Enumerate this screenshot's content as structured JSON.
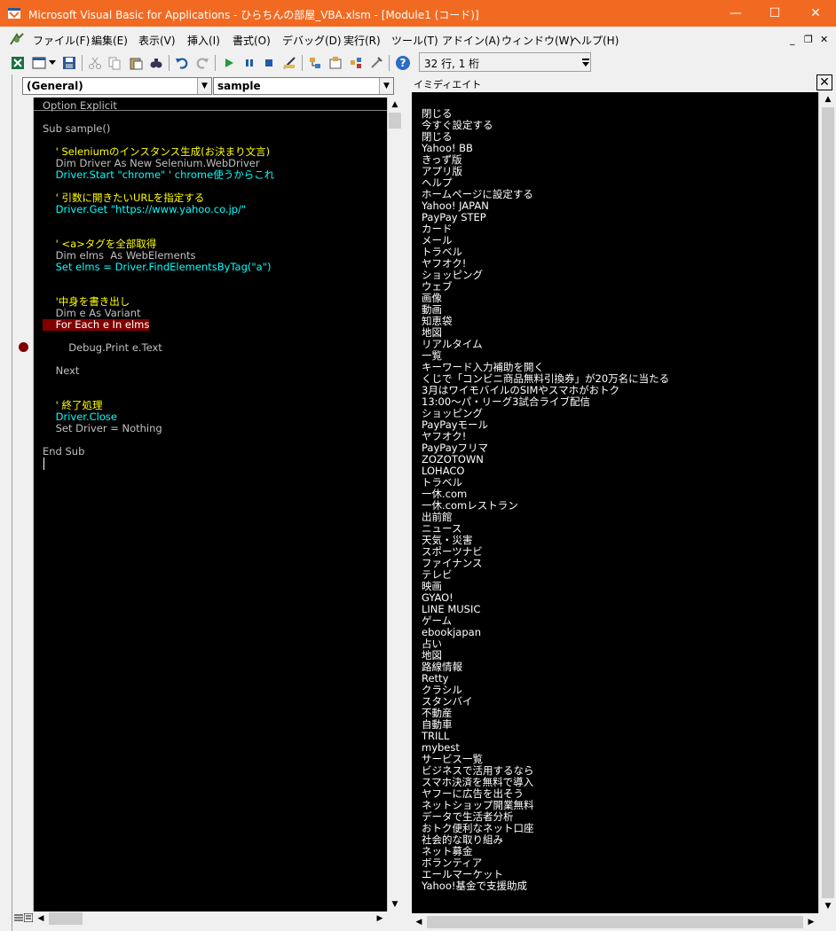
{
  "window": {
    "title": "Microsoft Visual Basic for Applications - ひらちんの部屋_VBA.xlsm - [Module1 (コード)]",
    "minimize": "—",
    "maximize": "☐",
    "close": "✕",
    "accent_color": "#f26a21"
  },
  "menubar": {
    "items": [
      "ファイル(F)",
      "編集(E)",
      "表示(V)",
      "挿入(I)",
      "書式(O)",
      "デバッグ(D)",
      "実行(R)",
      "ツール(T)",
      "アドイン(A)",
      "ウィンドウ(W)",
      "ヘルプ(H)"
    ],
    "mdi_minimize": "_",
    "mdi_restore": "❐",
    "mdi_close": "✕"
  },
  "toolbar": {
    "cursor_position": "32 行, 1 桁"
  },
  "code_window": {
    "object_combo": "(General)",
    "procedure_combo": "sample",
    "lines": [
      {
        "text": "Option Explicit",
        "color": "#c0c0c0"
      },
      {
        "text": "",
        "color": "#c0c0c0"
      },
      {
        "text": "Sub sample()",
        "color": "#c0c0c0"
      },
      {
        "text": "",
        "color": "#c0c0c0"
      },
      {
        "text": "    ' Seleniumのインスタンス生成(お決まり文言)",
        "color": "#ffff00"
      },
      {
        "text": "    Dim Driver As New Selenium.WebDriver",
        "color": "#c0c0c0"
      },
      {
        "text": "    Driver.Start \"chrome\" ' chrome使うからこれ",
        "color": "#00ffff"
      },
      {
        "text": "",
        "color": "#c0c0c0"
      },
      {
        "text": "    ' 引数に開きたいURLを指定する",
        "color": "#ffff00"
      },
      {
        "text": "    Driver.Get \"https://www.yahoo.co.jp/\"",
        "color": "#00ffff"
      },
      {
        "text": "",
        "color": "#c0c0c0"
      },
      {
        "text": "",
        "color": "#c0c0c0"
      },
      {
        "text": "    ' <a>タグを全部取得",
        "color": "#ffff00"
      },
      {
        "text": "    Dim elms  As WebElements",
        "color": "#c0c0c0"
      },
      {
        "text": "    Set elms = Driver.FindElementsByTag(\"a\")",
        "color": "#00ffff"
      },
      {
        "text": "",
        "color": "#c0c0c0"
      },
      {
        "text": "",
        "color": "#c0c0c0"
      },
      {
        "text": "    '中身を書き出し",
        "color": "#ffff00"
      },
      {
        "text": "    Dim e As Variant",
        "color": "#c0c0c0"
      },
      {
        "text": "    For Each e In elms",
        "color": "#ffffff",
        "breakpoint": true
      },
      {
        "text": "",
        "color": "#c0c0c0"
      },
      {
        "text": "        Debug.Print e.Text",
        "color": "#c0c0c0"
      },
      {
        "text": "",
        "color": "#c0c0c0"
      },
      {
        "text": "    Next",
        "color": "#c0c0c0"
      },
      {
        "text": "",
        "color": "#c0c0c0"
      },
      {
        "text": "",
        "color": "#c0c0c0"
      },
      {
        "text": "    ' 終了処理",
        "color": "#ffff00"
      },
      {
        "text": "    Driver.Close",
        "color": "#00ffff"
      },
      {
        "text": "    Set Driver = Nothing",
        "color": "#c0c0c0"
      },
      {
        "text": "",
        "color": "#c0c0c0"
      },
      {
        "text": "End Sub",
        "color": "#c0c0c0"
      }
    ]
  },
  "immediate_window": {
    "title": "イミディエイト",
    "close": "✕",
    "lines": [
      "閉じる",
      "今すぐ設定する",
      "閉じる",
      "Yahoo! BB",
      "きっず版",
      "アプリ版",
      "ヘルプ",
      "ホームページに設定する",
      "Yahoo! JAPAN",
      "PayPay STEP",
      "カード",
      "メール",
      "トラベル",
      "ヤフオク!",
      "ショッピング",
      "ウェブ",
      "画像",
      "動画",
      "知恵袋",
      "地図",
      "リアルタイム",
      "一覧",
      "キーワード入力補助を開く",
      "くじで「コンビニ商品無料引換券」が20万名に当たる",
      "3月はワイモバイルのSIMやスマホがおトク",
      "13:00〜パ・リーグ3試合ライブ配信",
      "ショッピング",
      "PayPayモール",
      "ヤフオク!",
      "PayPayフリマ",
      "ZOZOTOWN",
      "LOHACO",
      "トラベル",
      "一休.com",
      "一休.comレストラン",
      "出前館",
      "ニュース",
      "天気・災害",
      "スポーツナビ",
      "ファイナンス",
      "テレビ",
      "映画",
      "GYAO!",
      "LINE MUSIC",
      "ゲーム",
      "ebookjapan",
      "占い",
      "地図",
      "路線情報",
      "Retty",
      "クラシル",
      "スタンバイ",
      "不動産",
      "自動車",
      "TRILL",
      "mybest",
      "サービス一覧",
      "ビジネスで活用するなら",
      "スマホ決済を無料で導入",
      "ヤフーに広告を出そう",
      "ネットショップ開業無料",
      "データで生活者分析",
      "おトク便利なネット口座",
      "社会的な取り組み",
      "ネット募金",
      "ボランティア",
      "エールマーケット",
      "Yahoo!基金で支援助成"
    ]
  }
}
